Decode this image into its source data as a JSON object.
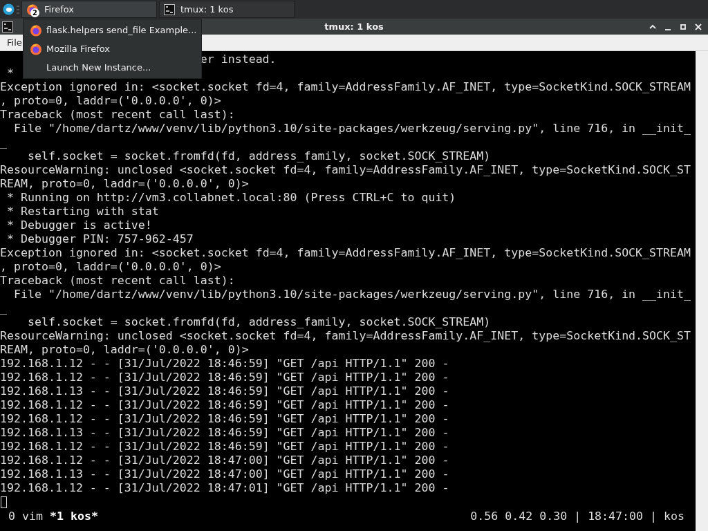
{
  "taskbar": {
    "tasks": [
      {
        "kind": "firefox",
        "label": "Firefox",
        "badge": "2",
        "selected": true
      },
      {
        "kind": "terminal",
        "label": "tmux: 1 kos",
        "selected": false
      }
    ]
  },
  "popup": {
    "items": [
      {
        "kind": "firefox",
        "label": "flask.helpers send_file Example..."
      },
      {
        "kind": "firefox",
        "label": "Mozilla Firefox"
      },
      {
        "kind": "plain",
        "label": "Launch New Instance..."
      }
    ]
  },
  "window": {
    "title": "tmux: 1 kos",
    "menu": [
      "File"
    ]
  },
  "terminal": {
    "lines": [
      "                             er instead.",
      " *",
      "Exception ignored in: <socket.socket fd=4, family=AddressFamily.AF_INET, type=SocketKind.SOCK_STREAM",
      ", proto=0, laddr=('0.0.0.0', 0)>",
      "Traceback (most recent call last):",
      "  File \"/home/dartz/www/venv/lib/python3.10/site-packages/werkzeug/serving.py\", line 716, in __init_",
      "_",
      "    self.socket = socket.fromfd(fd, address_family, socket.SOCK_STREAM)",
      "ResourceWarning: unclosed <socket.socket fd=4, family=AddressFamily.AF_INET, type=SocketKind.SOCK_ST",
      "REAM, proto=0, laddr=('0.0.0.0', 0)>",
      " * Running on http://vm3.collabnet.local:80 (Press CTRL+C to quit)",
      " * Restarting with stat",
      " * Debugger is active!",
      " * Debugger PIN: 757-962-457",
      "Exception ignored in: <socket.socket fd=4, family=AddressFamily.AF_INET, type=SocketKind.SOCK_STREAM",
      ", proto=0, laddr=('0.0.0.0', 0)>",
      "Traceback (most recent call last):",
      "  File \"/home/dartz/www/venv/lib/python3.10/site-packages/werkzeug/serving.py\", line 716, in __init_",
      "_",
      "    self.socket = socket.fromfd(fd, address_family, socket.SOCK_STREAM)",
      "ResourceWarning: unclosed <socket.socket fd=4, family=AddressFamily.AF_INET, type=SocketKind.SOCK_ST",
      "REAM, proto=0, laddr=('0.0.0.0', 0)>",
      "192.168.1.12 - - [31/Jul/2022 18:46:59] \"GET /api HTTP/1.1\" 200 -",
      "192.168.1.12 - - [31/Jul/2022 18:46:59] \"GET /api HTTP/1.1\" 200 -",
      "192.168.1.13 - - [31/Jul/2022 18:46:59] \"GET /api HTTP/1.1\" 200 -",
      "192.168.1.12 - - [31/Jul/2022 18:46:59] \"GET /api HTTP/1.1\" 200 -",
      "192.168.1.12 - - [31/Jul/2022 18:46:59] \"GET /api HTTP/1.1\" 200 -",
      "192.168.1.13 - - [31/Jul/2022 18:46:59] \"GET /api HTTP/1.1\" 200 -",
      "192.168.1.12 - - [31/Jul/2022 18:46:59] \"GET /api HTTP/1.1\" 200 -",
      "192.168.1.12 - - [31/Jul/2022 18:47:00] \"GET /api HTTP/1.1\" 200 -",
      "192.168.1.13 - - [31/Jul/2022 18:47:00] \"GET /api HTTP/1.1\" 200 -",
      "192.168.1.12 - - [31/Jul/2022 18:47:01] \"GET /api HTTP/1.1\" 200 -"
    ],
    "status_windows": [
      {
        "label": "0 vim",
        "selected": false
      },
      {
        "label": "*1 kos*",
        "selected": true
      }
    ],
    "status_right": "0.56 0.42 0.30 | 18:47:00 | kos"
  }
}
